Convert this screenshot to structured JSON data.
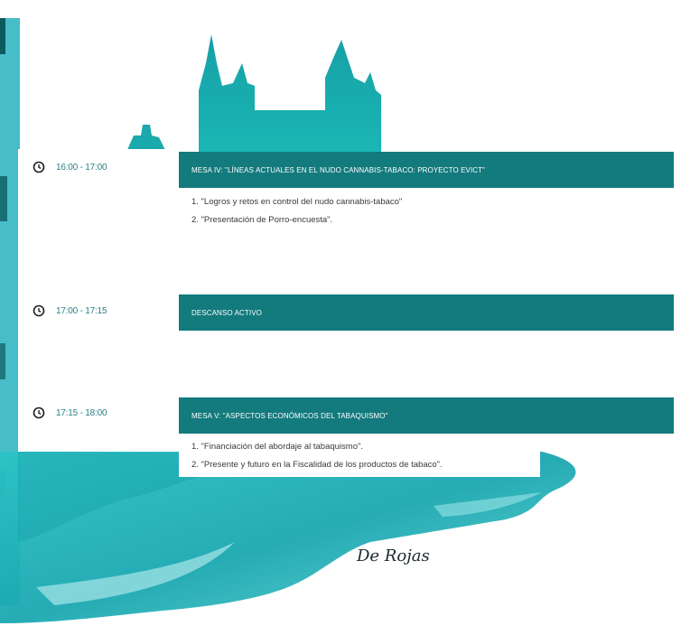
{
  "schedule": [
    {
      "time": "16:00 - 17:00",
      "title": "MESA IV: \"LÍNEAS ACTUALES EN EL NUDO CANNABIS-TABACO: PROYECTO EVICT\"",
      "items": [
        "1. \"Logros y retos en control del nudo cannabis-tabaco\"",
        "2. \"Presentación de Porro-encuesta\"."
      ]
    },
    {
      "time": "17:00 - 17:15",
      "title": "DESCANSO ACTIVO",
      "items": []
    },
    {
      "time": "17:15 - 18:00",
      "title": "MESA V: \"ASPECTOS ECONÓMICOS DEL TABAQUISMO\"",
      "items": [
        "1. \"Financiación del abordaje al tabaquismo\".",
        "2. \"Presente y futuro en la Fiscalidad de los productos de tabaco\"."
      ]
    }
  ],
  "signature": "De Rojas",
  "colors": {
    "accent": "#137a7d",
    "watercolor": "#1fb5bb"
  },
  "icons": {
    "time": "clock-icon"
  }
}
